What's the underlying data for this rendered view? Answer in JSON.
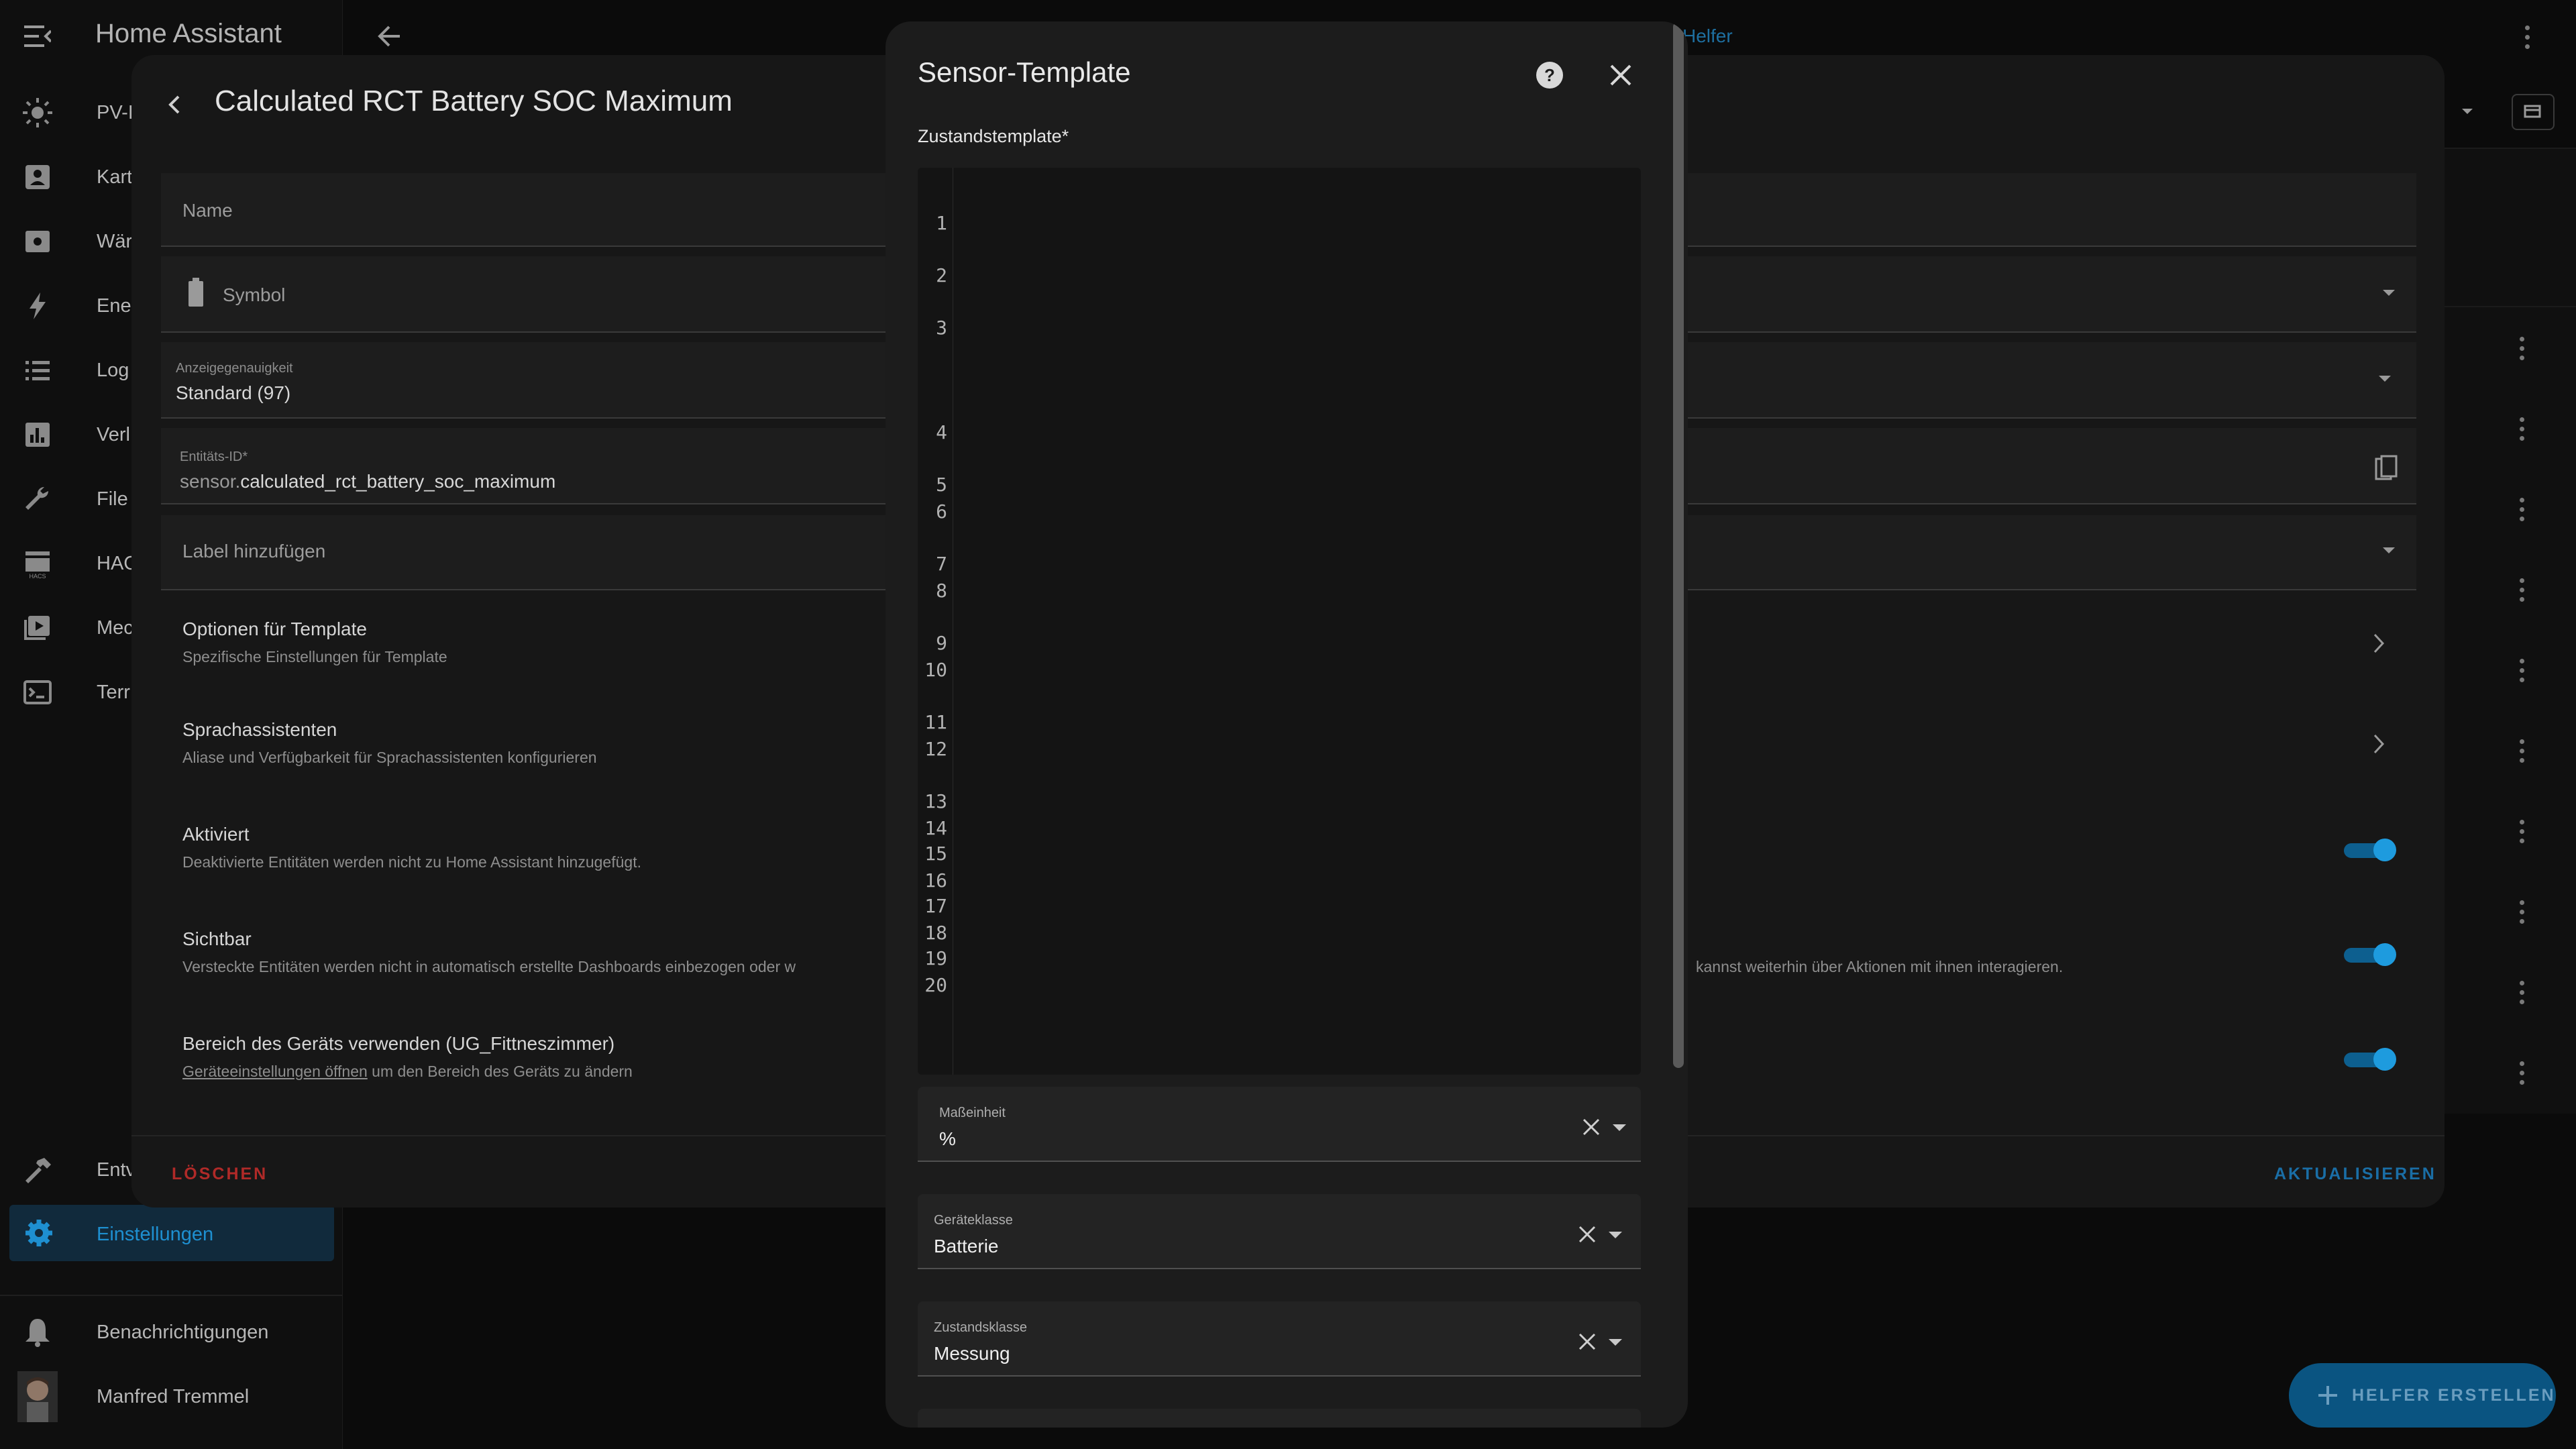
{
  "app": {
    "title": "Home Assistant",
    "helpers_link": "Helfer"
  },
  "sidebar": {
    "items": [
      {
        "label": "PV-I",
        "icon": "sun-icon"
      },
      {
        "label": "Kart",
        "icon": "account-box-icon"
      },
      {
        "label": "Wär",
        "icon": "radiator-icon"
      },
      {
        "label": "Ene",
        "icon": "lightning-icon"
      },
      {
        "label": "Log",
        "icon": "list-icon"
      },
      {
        "label": "Verl",
        "icon": "chart-icon"
      },
      {
        "label": "File",
        "icon": "wrench-icon"
      },
      {
        "label": "HAC",
        "icon": "hacs-icon"
      },
      {
        "label": "Mec",
        "icon": "media-icon"
      },
      {
        "label": "Terr",
        "icon": "terminal-icon"
      }
    ],
    "developer_label": "Entv",
    "settings_label": "Einstellungen",
    "notifications_label": "Benachrichtigungen",
    "user_name": "Manfred Tremmel"
  },
  "entity_dialog": {
    "title": "Calculated RCT Battery SOC Maximum",
    "name_placeholder": "Name",
    "symbol_label": "Symbol",
    "precision_label": "Anzeigegenauigkeit",
    "precision_value": "Standard (97)",
    "entity_id_label": "Entitäts-ID*",
    "entity_id_prefix": "sensor.",
    "entity_id_value": "calculated_rct_battery_soc_maximum",
    "add_label": "Label hinzufügen",
    "template_options_title": "Optionen für Template",
    "template_options_desc": "Spezifische Einstellungen für Template",
    "voice_title": "Sprachassistenten",
    "voice_desc": "Aliase und Verfügbarkeit für Sprachassistenten konfigurieren",
    "enabled_title": "Aktiviert",
    "enabled_desc": "Deaktivierte Entitäten werden nicht zu Home Assistant hinzugefügt.",
    "visible_title": "Sichtbar",
    "visible_desc_left": "Versteckte Entitäten werden nicht in automatisch erstellte Dashboards einbezogen oder w",
    "visible_desc_right": "kannst weiterhin über Aktionen mit ihnen interagieren.",
    "area_title": "Bereich des Geräts verwenden (UG_Fittneszimmer)",
    "area_link": "Geräteeinstellungen öffnen",
    "area_desc": " um den Bereich des Geräts zu ändern",
    "delete_label": "LÖSCHEN",
    "update_label": "AKTUALISIEREN"
  },
  "template_modal": {
    "title": "Sensor-Template",
    "state_template_label": "Zustandstemplate*",
    "line_numbers": [
      "1",
      "2",
      "3",
      "4",
      "5",
      "6",
      "7",
      "8",
      "9",
      "10",
      "11",
      "12",
      "13",
      "14",
      "15",
      "16",
      "17",
      "18",
      "19",
      "20"
    ],
    "unit_label": "Maßeinheit",
    "unit_value": "%",
    "device_class_label": "Geräteklasse",
    "device_class_value": "Batterie",
    "state_class_label": "Zustandsklasse",
    "state_class_value": "Messung"
  },
  "fab": {
    "label": "HELFER ERSTELLEN"
  },
  "colors": {
    "accent": "#1e9bde",
    "danger": "#e53935",
    "fab": "#0a5481"
  }
}
